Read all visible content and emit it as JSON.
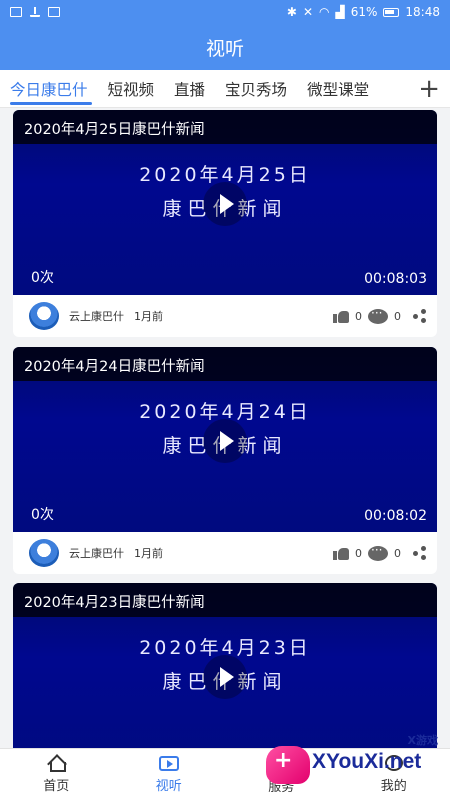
{
  "status_bar": {
    "battery": "61%",
    "time": "18:48"
  },
  "header": {
    "title": "视听"
  },
  "tabs": [
    {
      "label": "今日康巴什",
      "active": true
    },
    {
      "label": "短视频",
      "active": false
    },
    {
      "label": "直播",
      "active": false
    },
    {
      "label": "宝贝秀场",
      "active": false
    },
    {
      "label": "微型课堂",
      "active": false
    }
  ],
  "tabs_add_label": "+",
  "videos": [
    {
      "title": "2020年4月25日康巴什新闻",
      "overlay_date": "2020年4月25日",
      "overlay_sub": "康巴什新闻",
      "views": "0次",
      "duration": "00:08:03",
      "source": "云上康巴什",
      "time_ago": "1月前",
      "likes": "0",
      "comments": "0"
    },
    {
      "title": "2020年4月24日康巴什新闻",
      "overlay_date": "2020年4月24日",
      "overlay_sub": "康巴什新闻",
      "views": "0次",
      "duration": "00:08:02",
      "source": "云上康巴什",
      "time_ago": "1月前",
      "likes": "0",
      "comments": "0"
    },
    {
      "title": "2020年4月23日康巴什新闻",
      "overlay_date": "2020年4月23日",
      "overlay_sub": "康巴什新闻",
      "views": "",
      "duration": "",
      "source": "",
      "time_ago": "",
      "likes": "",
      "comments": ""
    }
  ],
  "bottom_nav": [
    {
      "label": "首页",
      "icon": "home-icon",
      "active": false
    },
    {
      "label": "视听",
      "icon": "tv-icon",
      "active": true
    },
    {
      "label": "服务",
      "icon": "grid-icon",
      "active": false
    },
    {
      "label": "我的",
      "icon": "more-icon",
      "active": false
    }
  ],
  "watermark": {
    "text": "XYouXi.net",
    "small": "X游戏"
  },
  "colors": {
    "primary": "#4d8ff0",
    "accent": "#3b7cea",
    "video_bg": "#000a8a"
  }
}
